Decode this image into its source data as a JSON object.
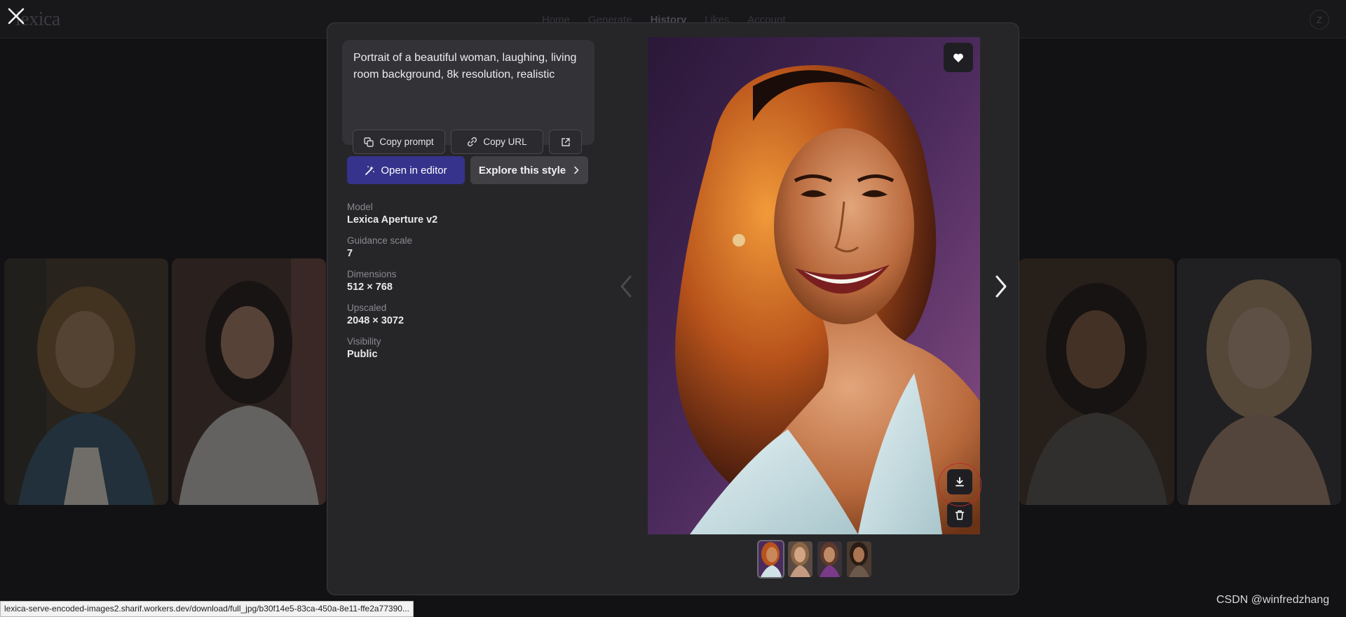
{
  "nav": {
    "logo": "lexica",
    "links": [
      "Home",
      "Generate",
      "History",
      "Likes",
      "Account"
    ],
    "active": "History",
    "avatar": "Z"
  },
  "prompt": {
    "text": "Portrait of a beautiful woman, laughing, living room background, 8k resolution, realistic",
    "copy_prompt_label": "Copy prompt",
    "copy_url_label": "Copy URL"
  },
  "actions": {
    "open_editor_label": "Open in editor",
    "explore_style_label": "Explore this style"
  },
  "meta": [
    {
      "label": "Model",
      "value": "Lexica Aperture v2"
    },
    {
      "label": "Guidance scale",
      "value": "7"
    },
    {
      "label": "Dimensions",
      "value": "512 × 768"
    },
    {
      "label": "Upscaled",
      "value": "2048 × 3072"
    },
    {
      "label": "Visibility",
      "value": "Public"
    }
  ],
  "icons": {
    "close": "close-icon",
    "like": "heart-icon",
    "download": "download-icon",
    "delete": "trash-icon",
    "prev": "chevron-left-icon",
    "next": "chevron-right-icon",
    "external": "external-link-icon"
  },
  "colors": {
    "accent": "#35338b",
    "modal_bg": "#262629",
    "highlight_ring": "#c12b2b"
  },
  "status_bar": {
    "url": "lexica-serve-encoded-images2.sharif.workers.dev/download/full_jpg/b30f14e5-83ca-450a-8e11-ffe2a77390..."
  },
  "watermark": "CSDN @winfredzhang"
}
